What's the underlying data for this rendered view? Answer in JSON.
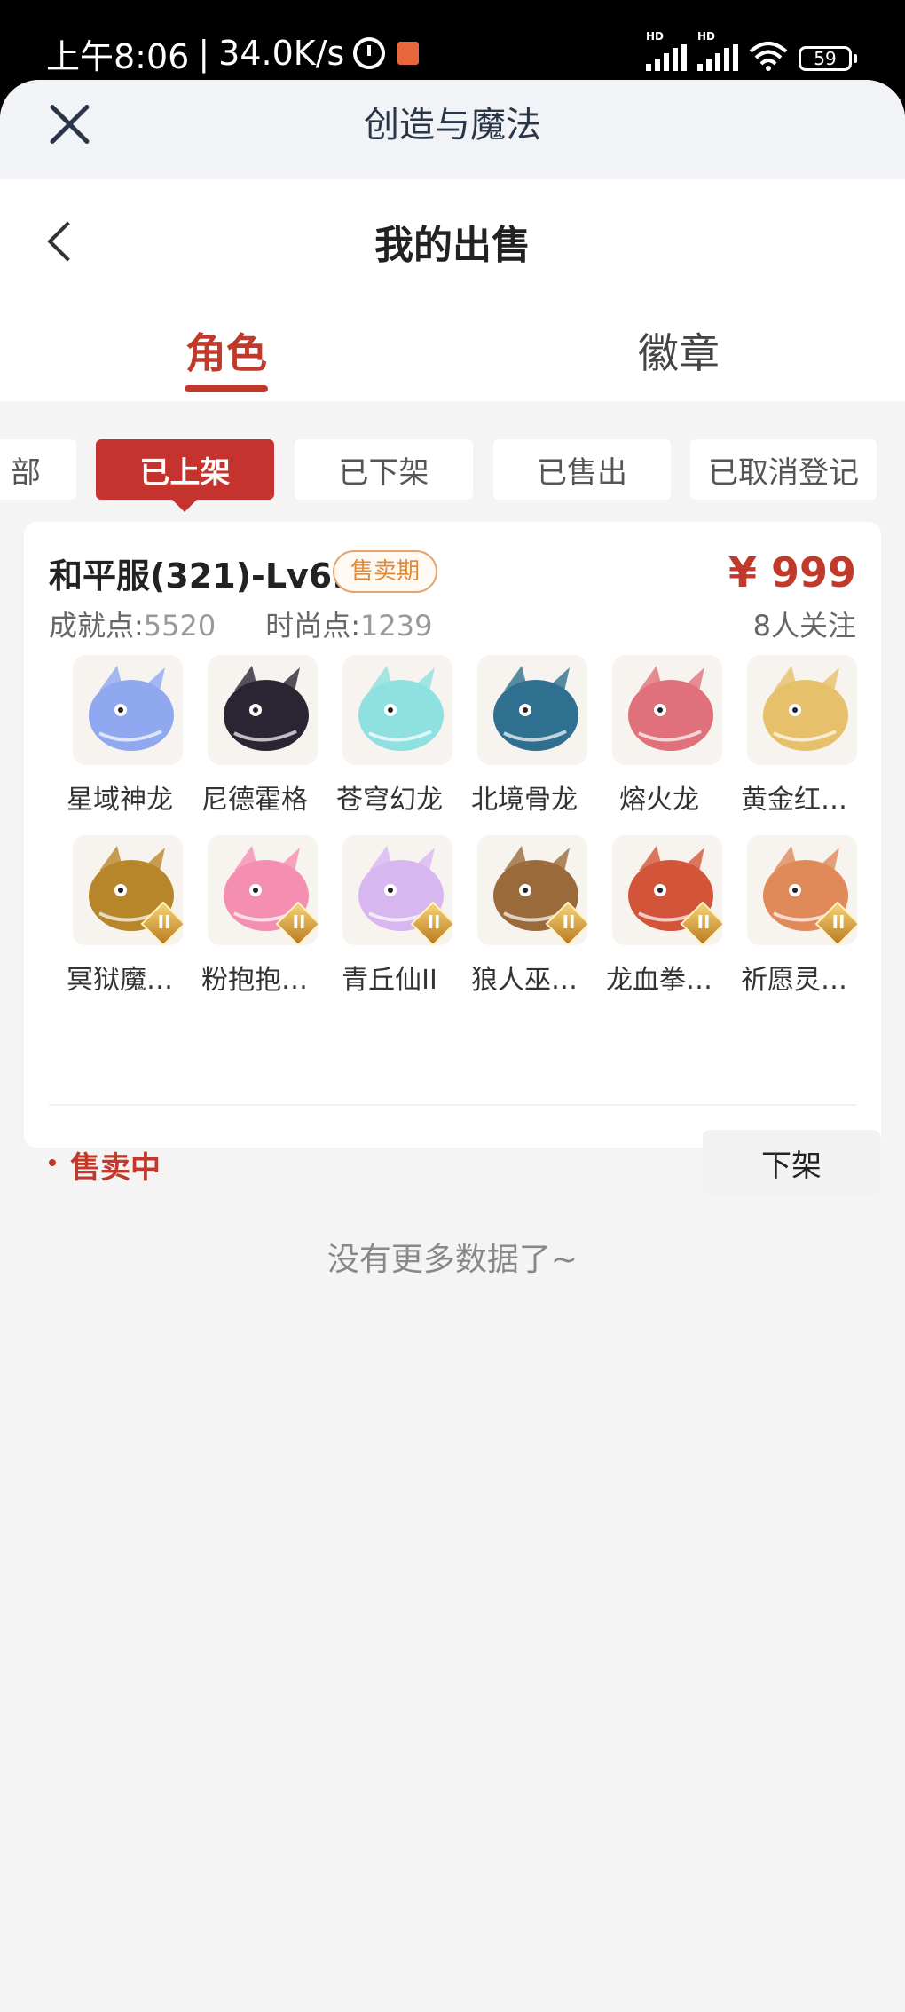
{
  "status_bar": {
    "time": "上午8:06",
    "separator": "|",
    "speed": "34.0K/s",
    "signal_label": "HD",
    "battery": "59"
  },
  "sheet": {
    "title": "创造与魔法"
  },
  "page": {
    "title": "我的出售"
  },
  "tabs": [
    {
      "label": "角色",
      "active": true
    },
    {
      "label": "徽章",
      "active": false
    }
  ],
  "filters": [
    {
      "label": "部",
      "active": false
    },
    {
      "label": "已上架",
      "active": true
    },
    {
      "label": "已下架",
      "active": false
    },
    {
      "label": "已售出",
      "active": false
    },
    {
      "label": "已取消登记",
      "active": false
    }
  ],
  "listing": {
    "server": "和平服(321)-Lv69",
    "period_badge": "售卖期",
    "price": "¥ 999",
    "achievement_label": "成就点:",
    "achievement_value": "5520",
    "fashion_label": "时尚点:",
    "fashion_value": "1239",
    "followers": "8人关注",
    "pets": [
      {
        "name": "星域神龙",
        "icon": "dragon-icon",
        "color": "#8fa8f0"
      },
      {
        "name": "尼德霍格",
        "icon": "dragon-icon",
        "color": "#2b2533"
      },
      {
        "name": "苍穹幻龙",
        "icon": "dragon-icon",
        "color": "#8fe0e0"
      },
      {
        "name": "北境骨龙",
        "icon": "dragon-icon",
        "color": "#2f6f8f"
      },
      {
        "name": "熔火龙",
        "icon": "dragon-icon",
        "color": "#e0707a"
      },
      {
        "name": "黄金红…",
        "icon": "dragon-icon",
        "color": "#e6c06a"
      },
      {
        "name": "冥狱魔…",
        "icon": "beast-icon",
        "color": "#b8862a"
      },
      {
        "name": "粉抱抱…",
        "icon": "bear-icon",
        "color": "#f48fb1"
      },
      {
        "name": "青丘仙II",
        "icon": "fox-spirit-icon",
        "color": "#d8b6f0"
      },
      {
        "name": "狼人巫…",
        "icon": "wolf-icon",
        "color": "#9a6a3a"
      },
      {
        "name": "龙血拳…",
        "icon": "beast-icon",
        "color": "#d2553a"
      },
      {
        "name": "祈愿灵…",
        "icon": "bird-icon",
        "color": "#e08a5a"
      }
    ],
    "status": "售卖中",
    "delist_button": "下架"
  },
  "footer": {
    "no_more": "没有更多数据了~"
  },
  "colors": {
    "accent": "#c0392b",
    "badge": "#e08b3a",
    "background": "#f4f4f5"
  }
}
